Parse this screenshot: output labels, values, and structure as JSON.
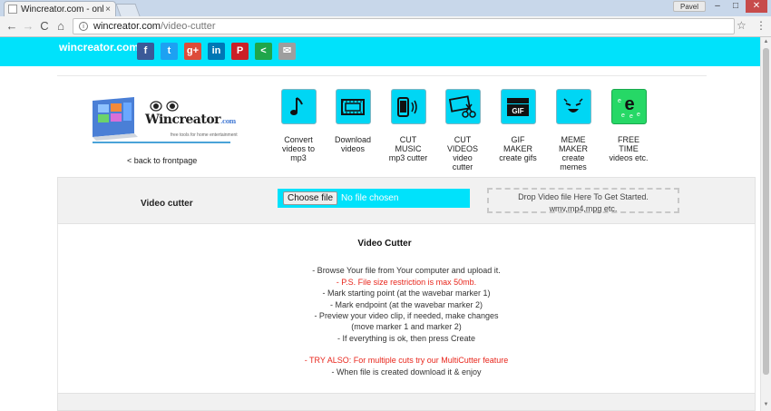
{
  "browser": {
    "tab_title": "Wincreator.com - online",
    "tab_close": "×",
    "user": "Pavel",
    "url_host": "wincreator.com",
    "url_path": "/video-cutter",
    "back": "←",
    "forward": "→",
    "reload": "C",
    "home": "⌂",
    "star": "☆",
    "menu": "⋮",
    "min": "–",
    "max": "□",
    "close": "✕"
  },
  "header": {
    "site_name": "wincreator.com",
    "social": [
      {
        "label": "f",
        "color": "#3b5998"
      },
      {
        "label": "t",
        "color": "#1da1f2"
      },
      {
        "label": "g+",
        "color": "#dd4b39"
      },
      {
        "label": "in",
        "color": "#0077b5"
      },
      {
        "label": "P",
        "color": "#cb2027"
      },
      {
        "label": "<",
        "color": "#1fa64a"
      },
      {
        "label": "✉",
        "color": "#9e9e9e"
      }
    ]
  },
  "logo": {
    "brand": "Wincreator",
    "brand_suffix": ".com",
    "tagline": "free tools for home entertainment"
  },
  "back_link": "< back to frontpage",
  "tools": [
    {
      "line1": "Convert",
      "line2": "videos to",
      "line3": "mp3",
      "line4": ""
    },
    {
      "line1": "Download",
      "line2": "videos",
      "line3": "",
      "line4": ""
    },
    {
      "line1": "CUT",
      "line2": "MUSIC",
      "line3": "mp3 cutter",
      "line4": ""
    },
    {
      "line1": "CUT",
      "line2": "VIDEOS",
      "line3": "video",
      "line4": "cutter"
    },
    {
      "line1": "GIF",
      "line2": "MAKER",
      "line3": "create gifs",
      "line4": ""
    },
    {
      "line1": "MEME",
      "line2": "MAKER",
      "line3": "create",
      "line4": "memes"
    },
    {
      "line1": "FREE",
      "line2": "TIME",
      "line3": "videos etc.",
      "line4": ""
    }
  ],
  "tool_icons": {
    "gif_text": "GIF",
    "free_e": "e"
  },
  "upload": {
    "label": "Video cutter",
    "choose_button": "Choose file",
    "no_file": "No file chosen",
    "drop_line1": "Drop Video file Here To Get Started.",
    "drop_line2": "wmv,mp4,mpg etc."
  },
  "instructions": {
    "title": "Video Cutter",
    "lines": [
      {
        "text": "- Browse Your file from Your computer and upload it.",
        "red": false
      },
      {
        "text": "- P.S. File size restriction is max 50mb.",
        "red": true
      },
      {
        "text": "- Mark starting point (at the wavebar marker 1)",
        "red": false
      },
      {
        "text": "- Mark endpoint (at the wavebar marker 2)",
        "red": false
      },
      {
        "text": "- Preview your video clip, if needed, make changes",
        "red": false
      },
      {
        "text": "(move marker 1 and marker 2)",
        "red": false
      },
      {
        "text": "- If everything is ok, then press Create",
        "red": false
      },
      {
        "text": "- TRY ALSO: For multiple cuts try our MultiCutter feature",
        "red": true
      },
      {
        "text": "- When file is created download it & enjoy",
        "red": false
      }
    ]
  }
}
